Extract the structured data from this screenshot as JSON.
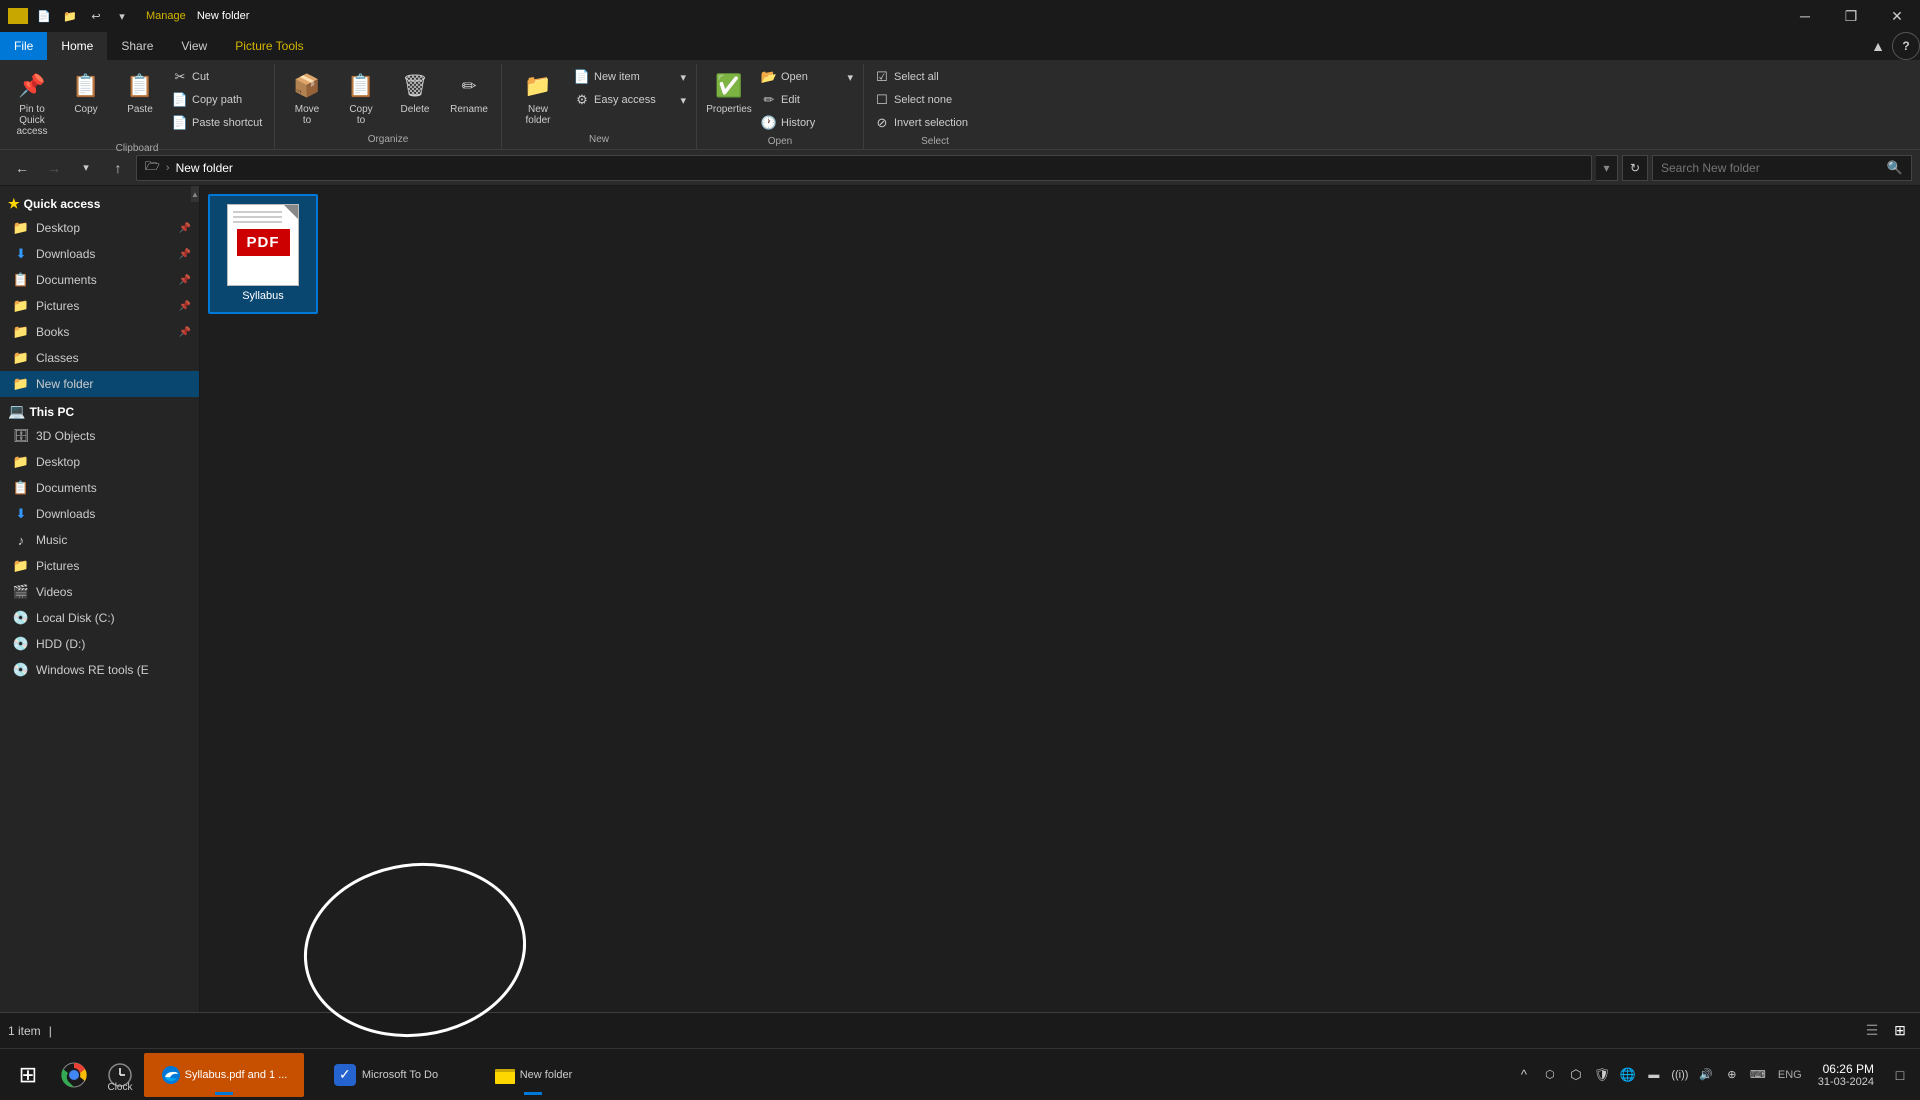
{
  "titleBar": {
    "manageLabel": "Manage",
    "folderLabel": "New folder",
    "minimizeTitle": "─",
    "restoreTitle": "❐",
    "closeTitle": "✕",
    "upArrow": "▲",
    "helpTitle": "?"
  },
  "ribbon": {
    "tabs": [
      {
        "id": "file",
        "label": "File",
        "active": false,
        "isFile": true
      },
      {
        "id": "home",
        "label": "Home",
        "active": true
      },
      {
        "id": "share",
        "label": "Share"
      },
      {
        "id": "view",
        "label": "View"
      },
      {
        "id": "picture-tools",
        "label": "Picture Tools",
        "isManage": true
      }
    ],
    "groups": {
      "clipboard": {
        "label": "Clipboard",
        "pinToQuickAccess": "Pin to Quick\naccess",
        "copy": "Copy",
        "paste": "Paste",
        "cut": "Cut",
        "copyPath": "Copy path",
        "pasteShortcut": "Paste shortcut"
      },
      "organize": {
        "label": "Organize",
        "moveTo": "Move\nto",
        "copyTo": "Copy\nto",
        "delete": "Delete",
        "rename": "Rename"
      },
      "new": {
        "label": "New",
        "newFolder": "New\nfolder",
        "newItem": "New item",
        "easyAccess": "Easy access"
      },
      "open": {
        "label": "Open",
        "open": "Open",
        "edit": "Edit",
        "history": "History",
        "properties": "Properties"
      },
      "select": {
        "label": "Select",
        "selectAll": "Select all",
        "selectNone": "Select none",
        "invertSelection": "Invert selection"
      }
    }
  },
  "navBar": {
    "backDisabled": false,
    "forwardDisabled": true,
    "upPath": "Up",
    "addressPath": "New folder",
    "searchPlaceholder": "Search New folder"
  },
  "sidebar": {
    "quickAccess": {
      "label": "Quick access",
      "items": [
        {
          "label": "Desktop",
          "icon": "📁",
          "pinned": true
        },
        {
          "label": "Downloads",
          "icon": "⬇",
          "pinned": true
        },
        {
          "label": "Documents",
          "icon": "📋",
          "pinned": true
        },
        {
          "label": "Pictures",
          "icon": "📁",
          "pinned": true
        },
        {
          "label": "Books",
          "icon": "📁",
          "pinned": true
        },
        {
          "label": "Classes",
          "icon": "📁",
          "pinned": false
        },
        {
          "label": "New folder",
          "icon": "📁",
          "pinned": false
        }
      ]
    },
    "thisPC": {
      "label": "This PC",
      "items": [
        {
          "label": "3D Objects",
          "icon": "🗄"
        },
        {
          "label": "Desktop",
          "icon": "📁"
        },
        {
          "label": "Documents",
          "icon": "📋"
        },
        {
          "label": "Downloads",
          "icon": "⬇"
        },
        {
          "label": "Music",
          "icon": "♪"
        },
        {
          "label": "Pictures",
          "icon": "📁"
        },
        {
          "label": "Videos",
          "icon": "🎬"
        },
        {
          "label": "Local Disk (C:)",
          "icon": "💾"
        },
        {
          "label": "HDD (D:)",
          "icon": "💾"
        },
        {
          "label": "Windows RE tools (E",
          "icon": "💾"
        }
      ]
    }
  },
  "fileArea": {
    "files": [
      {
        "name": "Syllabus",
        "type": "pdf",
        "selected": false
      }
    ]
  },
  "statusBar": {
    "count": "1 item",
    "separator": "|"
  },
  "taskbar": {
    "startIcon": "⊞",
    "apps": [
      {
        "name": "Chrome",
        "icon": "chrome",
        "running": false
      },
      {
        "name": "Clock",
        "icon": "clock",
        "running": false
      },
      {
        "name": "Edge-Syllabus",
        "icon": "edge",
        "running": true,
        "label": "Syllabus.pdf and 1 ..."
      },
      {
        "name": "MicrosoftToDo",
        "icon": "todo",
        "running": false,
        "label": "Microsoft To Do"
      },
      {
        "name": "FileExplorer",
        "icon": "folder",
        "running": true,
        "label": "New folder"
      }
    ],
    "systray": {
      "chevron": "^",
      "bluetooth": "⬡",
      "action": "⊕",
      "network": "🌐",
      "speaker": "🔊",
      "battery": "🔋",
      "time": "06:26 PM",
      "date": "31-03-2024",
      "lang": "ENG",
      "notification": "🔔"
    }
  }
}
